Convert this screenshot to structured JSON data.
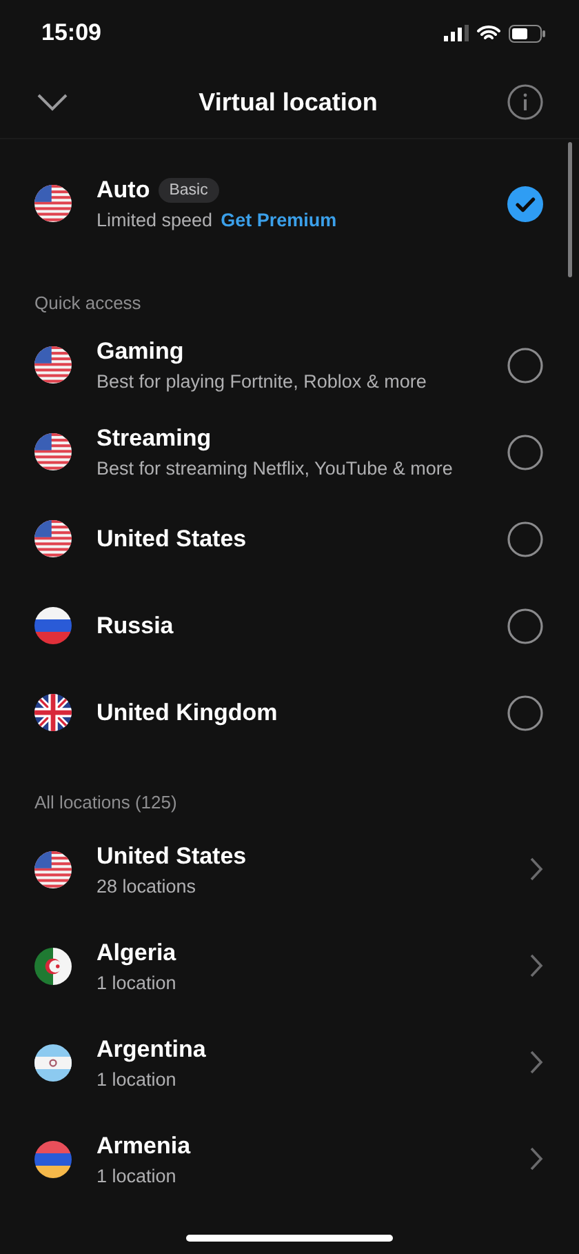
{
  "status_bar": {
    "time": "15:09"
  },
  "header": {
    "title": "Virtual location"
  },
  "auto": {
    "kind": "us",
    "name": "Auto",
    "badge": "Basic",
    "subtitle": "Limited speed",
    "link": "Get Premium",
    "selected": true
  },
  "quick_access": {
    "heading": "Quick access",
    "items": [
      {
        "kind": "us",
        "name": "Gaming",
        "subtitle": "Best for playing Fortnite, Roblox & more",
        "selected": false
      },
      {
        "kind": "us",
        "name": "Streaming",
        "subtitle": "Best for streaming Netflix, YouTube & more",
        "selected": false
      },
      {
        "kind": "us",
        "name": "United States",
        "selected": false
      },
      {
        "kind": "ru",
        "name": "Russia",
        "selected": false
      },
      {
        "kind": "uk",
        "name": "United Kingdom",
        "selected": false
      }
    ]
  },
  "all_locations": {
    "heading": "All locations (125)",
    "items": [
      {
        "kind": "us",
        "name": "United States",
        "subtitle": "28 locations"
      },
      {
        "kind": "dz",
        "name": "Algeria",
        "subtitle": "1 location"
      },
      {
        "kind": "ar",
        "name": "Argentina",
        "subtitle": "1 location"
      },
      {
        "kind": "am",
        "name": "Armenia",
        "subtitle": "1 location"
      }
    ]
  }
}
